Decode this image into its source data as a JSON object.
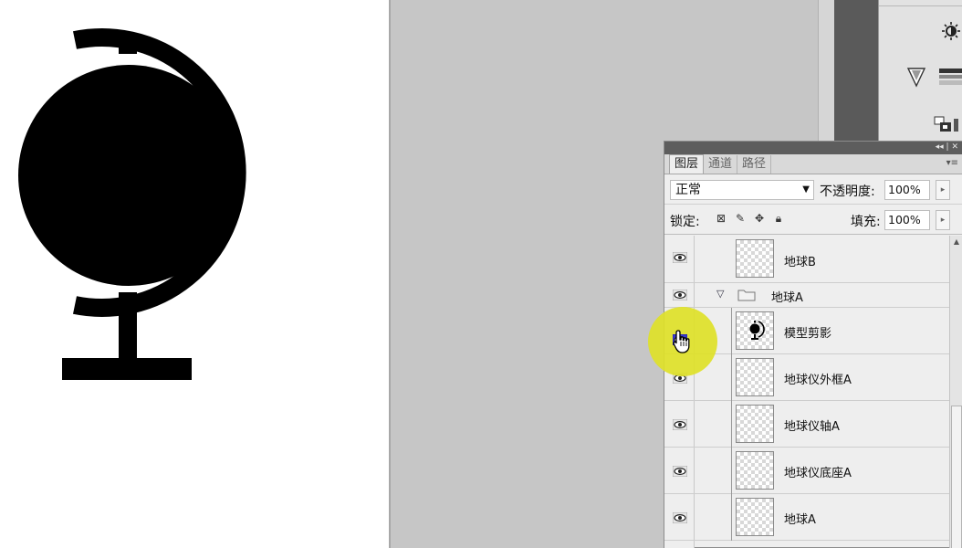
{
  "document": {
    "artwork": "globe-silhouette"
  },
  "tools_panel": {
    "icons": [
      "brightness-icon",
      "gradient-map-icon",
      "channel-mixer-icon"
    ]
  },
  "layers_panel": {
    "tabs": [
      {
        "label": "图层",
        "active": true
      },
      {
        "label": "通道",
        "active": false
      },
      {
        "label": "路径",
        "active": false
      }
    ],
    "blend_mode": "正常",
    "opacity_label": "不透明度:",
    "opacity_value": "100%",
    "lock_label": "锁定:",
    "fill_label": "填充:",
    "fill_value": "100%",
    "layers": [
      {
        "name": "地球B",
        "type": "layer",
        "visible": true,
        "thumb": "empty"
      },
      {
        "name": "地球A",
        "type": "group",
        "visible": true,
        "expanded": true
      },
      {
        "name": "模型剪影",
        "type": "layer",
        "visible": true,
        "thumb": "globe"
      },
      {
        "name": "地球仪外框A",
        "type": "layer",
        "visible": true,
        "thumb": "empty"
      },
      {
        "name": "地球仪轴A",
        "type": "layer",
        "visible": true,
        "thumb": "empty"
      },
      {
        "name": "地球仪底座A",
        "type": "layer",
        "visible": true,
        "thumb": "empty"
      },
      {
        "name": "地球A",
        "type": "layer",
        "visible": true,
        "thumb": "empty"
      }
    ]
  },
  "colors": {
    "artwork": "#000000",
    "canvas": "#ffffff",
    "workspace": "#c6c6c6",
    "cursor_highlight": "#dee128"
  }
}
